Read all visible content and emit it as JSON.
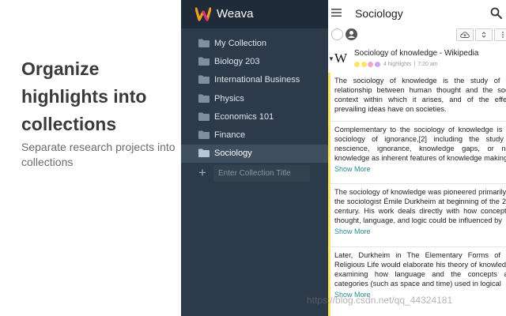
{
  "promo": {
    "title": "Organize highlights into collections",
    "subtitle": "Separate research projects into collections"
  },
  "app": {
    "name": "Weava",
    "logo_color": "#f0a020",
    "logo_accent": "#e0307a"
  },
  "sidebar": {
    "background": "#2c3a49",
    "items": [
      {
        "label": "My Collection",
        "icon": "folder-icon"
      },
      {
        "label": "Biology 203",
        "icon": "folder-icon"
      },
      {
        "label": "International Business",
        "icon": "folder-icon"
      },
      {
        "label": "Physics",
        "icon": "folder-icon"
      },
      {
        "label": "Economics 101",
        "icon": "folder-icon"
      },
      {
        "label": "Finance",
        "icon": "folder-icon"
      },
      {
        "label": "Sociology",
        "icon": "folder-icon",
        "active": true
      }
    ],
    "add_placeholder": "Enter Collection Title"
  },
  "panel": {
    "title": "Sociology",
    "source": {
      "logo": "W",
      "title": "Sociology of knowledge - Wikipedia",
      "highlights_count": "4 highlights",
      "time": "7:20 am",
      "dot_colors": [
        "#ffe566",
        "#ffe566",
        "#f5a3d0",
        "#c9a8f5"
      ]
    },
    "highlights": [
      {
        "text": "The sociology of knowledge is the study of the relationship between human thought and the social context within which it arises, and of the effects prevailing ideas have on societies.",
        "show_more": ""
      },
      {
        "text": "Complementary to the sociology of knowledge is the sociology of ignorance,[2] including the study of nescience, ignorance, knowledge gaps, or non-knowledge as inherent features of knowledge making.",
        "show_more": "Show More"
      },
      {
        "text": "The sociology of knowledge was pioneered primarily by the sociologist Émile Durkheim at beginning of the 20th century. His work deals directly with how conceptual thought, language, and logic could be influenced by",
        "show_more": "Show More"
      },
      {
        "text": "Later, Durkheim in The Elementary Forms of the Religious Life would elaborate his theory of knowledge, examining how language and the concepts and categories (such as space and time) used in logical",
        "show_more": "Show More"
      }
    ],
    "highlight_color": "#ffe566"
  },
  "watermark": "https://blog.csdn.net/qq_44324181"
}
